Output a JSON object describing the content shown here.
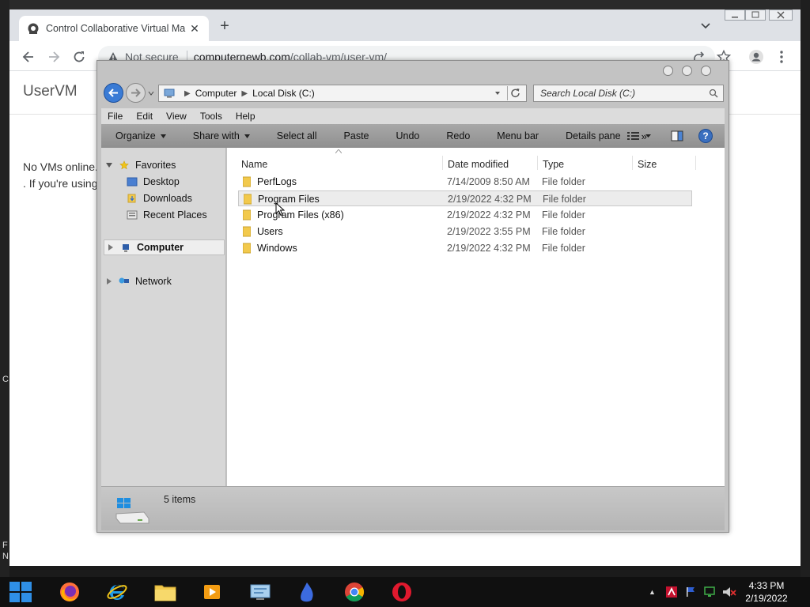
{
  "desktop": {
    "left_glyph_top": "C",
    "left_glyph_bottom_1": "F",
    "left_glyph_bottom_2": "N"
  },
  "browser": {
    "tab_title": "Control Collaborative Virtual Ma",
    "tab_close": "✕",
    "new_tab": "+",
    "security_label": "Not secure",
    "url_host": "computernewb.com",
    "url_path": "/collab-vm/user-vm/",
    "accent": "#1a73e8"
  },
  "page": {
    "brand": "UserVM",
    "message_line1": "No VMs online.",
    "message_line2": ". If you're using"
  },
  "explorer": {
    "address": {
      "crumb1": "Computer",
      "crumb2": "Local Disk (C:)"
    },
    "search_placeholder": "Search Local Disk (C:)",
    "menu": [
      "File",
      "Edit",
      "View",
      "Tools",
      "Help"
    ],
    "commands": {
      "organize": "Organize",
      "share_with": "Share with",
      "select_all": "Select all",
      "paste": "Paste",
      "undo": "Undo",
      "redo": "Redo",
      "menu_bar": "Menu bar",
      "details_pane": "Details pane",
      "more": "»",
      "help": "?"
    },
    "nav": {
      "favorites": "Favorites",
      "desktop": "Desktop",
      "downloads": "Downloads",
      "recent_places": "Recent Places",
      "computer": "Computer",
      "network": "Network"
    },
    "columns": {
      "name": "Name",
      "date_modified": "Date modified",
      "type": "Type",
      "size": "Size"
    },
    "files": [
      {
        "name": "PerfLogs",
        "date": "7/14/2009 8:50 AM",
        "type": "File folder"
      },
      {
        "name": "Program Files",
        "date": "2/19/2022 4:32 PM",
        "type": "File folder"
      },
      {
        "name": "Program Files (x86)",
        "date": "2/19/2022 4:32 PM",
        "type": "File folder"
      },
      {
        "name": "Users",
        "date": "2/19/2022 3:55 PM",
        "type": "File folder"
      },
      {
        "name": "Windows",
        "date": "2/19/2022 4:32 PM",
        "type": "File folder"
      }
    ],
    "status": "5 items",
    "folder_color": "#f2c94c"
  },
  "taskbar": {
    "time": "4:33 PM",
    "date": "2/19/2022",
    "tray_up": "▲"
  }
}
